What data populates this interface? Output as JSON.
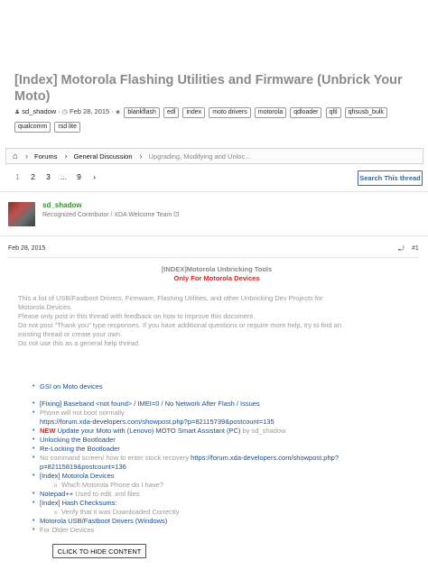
{
  "thread": {
    "title": "[Index] Motorola Flashing Utilities and Firmware (Unbrick Your Moto)",
    "author": "sd_shadow",
    "date": "Feb 28, 2015",
    "tags": [
      "blankflash",
      "edl",
      "index",
      "moto drivers",
      "motorola",
      "qdloader",
      "qfil",
      "qhsusb_bulk",
      "qualcomm",
      "rsd lite"
    ]
  },
  "breadcrumb": {
    "items": [
      "Forums",
      "General Discussion",
      "Upgrading, Modifying and Unloc..."
    ]
  },
  "pagination": {
    "pages": [
      "1",
      "2",
      "3",
      "...",
      "9"
    ],
    "next": "›",
    "search_label": "Search This thread"
  },
  "post": {
    "username": "sd_shadow",
    "role": "Recognized Contributor / XDA Welcome Team",
    "date": "Feb 28, 2015",
    "number": "#1",
    "heading": "[INDEX]Motorola Unbricking Tools",
    "subheading": "Only For Motorola Devices",
    "intro": [
      "This a list of USB/Fastboot Drivers, Firmware, Flashing Utilities, and other Unbricking Dev Projects for Motorola Devices.",
      "Please only post in this thread with feedback on how to improve this document.",
      "Do not post \"Thank you\" type responses. If you have additional questions or require more help, try to find an existing thread or create your own.",
      "Do not use this as a general help thread."
    ],
    "list": {
      "gsi": "GSI on Moto devices",
      "baseband": "[Fixing] Baseband <not found> / IMEI=0 / No Network After Flash / Issues",
      "no_boot": "Phone will not boot normally",
      "no_boot_link": "https://forum.xda-developers.com/showpost.php?p=82115739&postcount=135",
      "new_badge": "NEW",
      "update": "Update your Moto with (Lenovo) MOTO Smart Assistant (PC)",
      "update_by": " by sd_shadow",
      "unlock": "Unlocking the Bootloader",
      "relock": "Re-Locking the Bootloader",
      "no_cmd": "No command screen/ how to enter stock recovery ",
      "no_cmd_link": "https://forum.xda-developers.com/showpost.php?p=82115819&postcount=136",
      "devices": "[Index] Motorola Devices",
      "which_phone": "Which Motorola Phone do I have?",
      "notepad": "Notepad++",
      "notepad_desc": " Used to edit .xml files",
      "hash": "[Index] Hash Checksums:",
      "verify": "Verify that it was Downloaded Correctly",
      "drivers": "Motorola USB/Fastboot Drivers (Windows)",
      "older": "For Older Devices"
    },
    "hide_button": "CLICK TO HIDE CONTENT"
  }
}
